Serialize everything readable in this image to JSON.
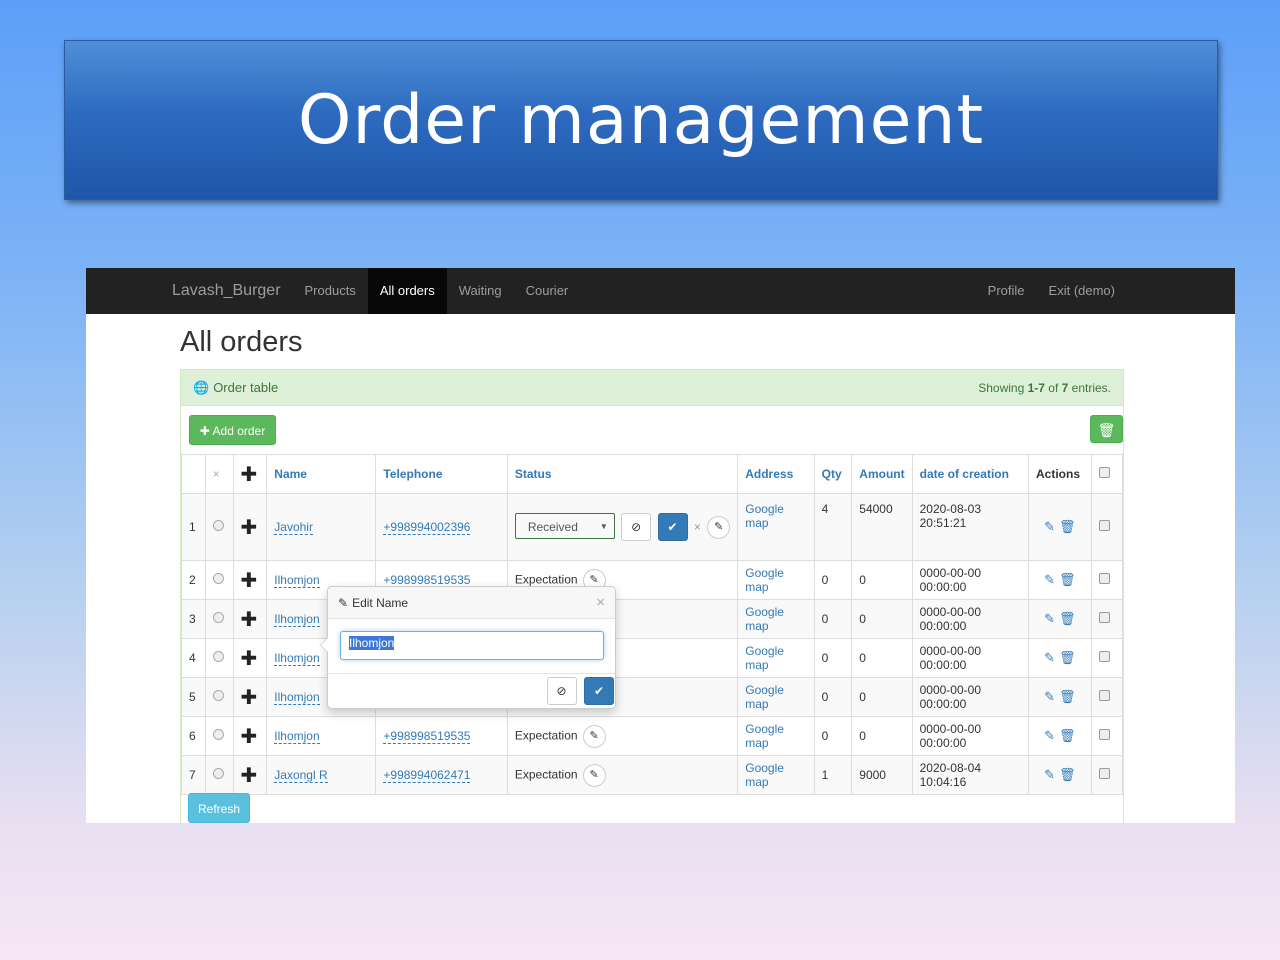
{
  "slide": {
    "title": "Order management"
  },
  "navbar": {
    "brand": "Lavash_Burger",
    "items": [
      {
        "label": "Products",
        "active": false
      },
      {
        "label": "All orders",
        "active": true
      },
      {
        "label": "Waiting",
        "active": false
      },
      {
        "label": "Courier",
        "active": false
      }
    ],
    "right": [
      {
        "label": "Profile"
      },
      {
        "label": "Exit (demo)"
      }
    ]
  },
  "page": {
    "title": "All orders"
  },
  "panel": {
    "heading": "Order table",
    "showing": {
      "prefix": "Showing ",
      "range": "1-7",
      "mid": " of ",
      "total": "7",
      "suffix": " entries."
    },
    "add_button": "Add order",
    "refresh_button": "Refresh"
  },
  "table": {
    "headers": {
      "x": "×",
      "plus": "✚",
      "name": "Name",
      "telephone": "Telephone",
      "status": "Status",
      "address": "Address",
      "qty": "Qty",
      "amount": "Amount",
      "date": "date of creation",
      "actions": "Actions"
    },
    "rows": [
      {
        "n": "1",
        "name": "Javohir",
        "telephone": "+998994002396",
        "status": "Received",
        "address": "Google map",
        "qty": "4",
        "amount": "54000",
        "date": "2020-08-03 20:51:21"
      },
      {
        "n": "2",
        "name": "Ilhomjon",
        "telephone": "+998998519535",
        "status": "Expectation",
        "address": "Google map",
        "qty": "0",
        "amount": "0",
        "date": "0000-00-00 00:00:00"
      },
      {
        "n": "3",
        "name": "Ilhomjon",
        "telephone": "",
        "status": "",
        "address": "Google map",
        "qty": "0",
        "amount": "0",
        "date": "0000-00-00 00:00:00"
      },
      {
        "n": "4",
        "name": "Ilhomjon",
        "telephone": "",
        "status": "",
        "address": "Google map",
        "qty": "0",
        "amount": "0",
        "date": "0000-00-00 00:00:00"
      },
      {
        "n": "5",
        "name": "Ilhomjon",
        "telephone": "",
        "status": "",
        "address": "Google map",
        "qty": "0",
        "amount": "0",
        "date": "0000-00-00 00:00:00"
      },
      {
        "n": "6",
        "name": "Ilhomjon",
        "telephone": "+998998519535",
        "status": "Expectation",
        "address": "Google map",
        "qty": "0",
        "amount": "0",
        "date": "0000-00-00 00:00:00"
      },
      {
        "n": "7",
        "name": "Jaxongl R",
        "telephone": "+998994062471",
        "status": "Expectation",
        "address": "Google map",
        "qty": "1",
        "amount": "9000",
        "date": "2020-08-04 10:04:16"
      }
    ]
  },
  "popover": {
    "title": "Edit Name",
    "value": "Ilhomjon"
  },
  "colors": {
    "navbar": "#222222",
    "panel_heading": "#dff0d8",
    "success": "#5cb85c",
    "info": "#5bc0de",
    "primary": "#337ab7",
    "banner": "#2e6bc0"
  }
}
